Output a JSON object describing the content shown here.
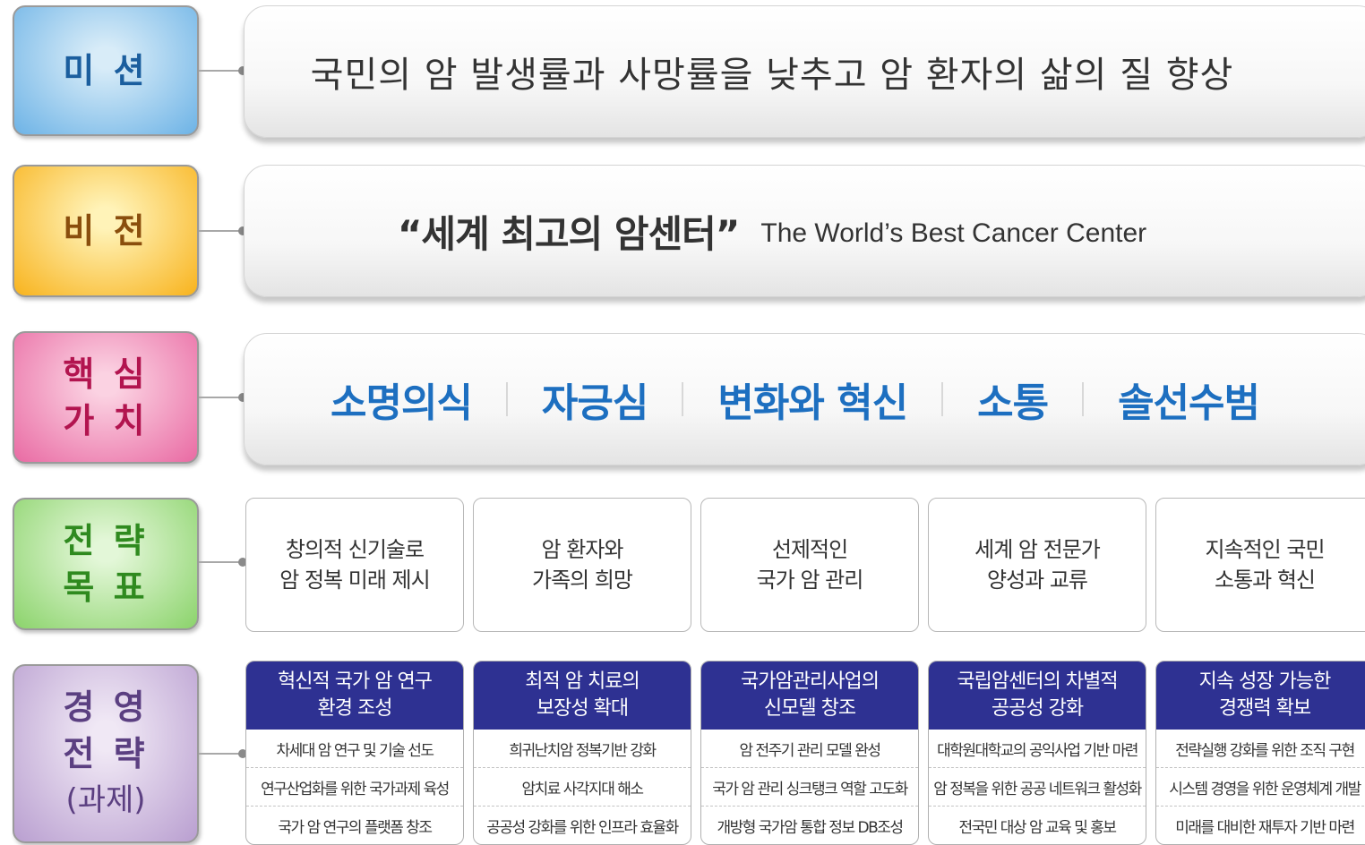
{
  "rows": {
    "mission": {
      "label": "미 션",
      "text": "국민의 암 발생률과 사망률을 낮추고 암 환자의 삶의 질 향상"
    },
    "vision": {
      "label": "비 전",
      "text_kr": "“세계 최고의 암센터”",
      "text_en": "The World’s Best Cancer Center"
    },
    "core_values": {
      "label_line1": "핵 심",
      "label_line2": "가 치",
      "items": [
        "소명의식",
        "자긍심",
        "변화와 혁신",
        "소통",
        "솔선수범"
      ]
    },
    "strategic_goals": {
      "label_line1": "전 략",
      "label_line2": "목 표",
      "items": [
        [
          "창의적 신기술로",
          "암 정복 미래 제시"
        ],
        [
          "암 환자와",
          "가족의 희망"
        ],
        [
          "선제적인",
          "국가 암 관리"
        ],
        [
          "세계 암 전문가",
          "양성과 교류"
        ],
        [
          "지속적인 국민",
          "소통과 혁신"
        ]
      ]
    },
    "management_strategy": {
      "label_line1": "경 영",
      "label_line2": "전 략",
      "label_line3": "(과제)",
      "columns": [
        {
          "title": [
            "혁신적 국가 암 연구",
            "환경 조성"
          ],
          "tasks": [
            "차세대 암 연구 및 기술 선도",
            "연구산업화를 위한 국가과제 육성",
            "국가 암 연구의 플랫폼 창조"
          ]
        },
        {
          "title": [
            "최적 암 치료의",
            "보장성 확대"
          ],
          "tasks": [
            "희귀난치암 정복기반 강화",
            "암치료 사각지대 해소",
            "공공성 강화를 위한 인프라 효율화"
          ]
        },
        {
          "title": [
            "국가암관리사업의",
            "신모델 창조"
          ],
          "tasks": [
            "암 전주기 관리 모델 완성",
            "국가 암 관리 싱크탱크 역할 고도화",
            "개방형 국가암 통합 정보 DB조성"
          ]
        },
        {
          "title": [
            "국립암센터의 차별적",
            "공공성 강화"
          ],
          "tasks": [
            "대학원대학교의 공익사업 기반 마련",
            "암 정복을 위한 공공 네트워크 활성화",
            "전국민 대상 암 교육 및 홍보"
          ]
        },
        {
          "title": [
            "지속 성장 가능한",
            "경쟁력 확보"
          ],
          "tasks": [
            "전략실행 강화를 위한 조직 구현",
            "시스템 경영을 위한 운영체계 개발",
            "미래를 대비한 재투자 기반 마련"
          ]
        }
      ]
    }
  },
  "colors": {
    "mission": "#6db3e6",
    "vision": "#f8b31d",
    "core_values": "#e96aa3",
    "strategic_goals": "#8bd36b",
    "management_strategy": "#b99fd0",
    "value_text": "#1d6fc0",
    "strategy_header": "#2e3192"
  }
}
